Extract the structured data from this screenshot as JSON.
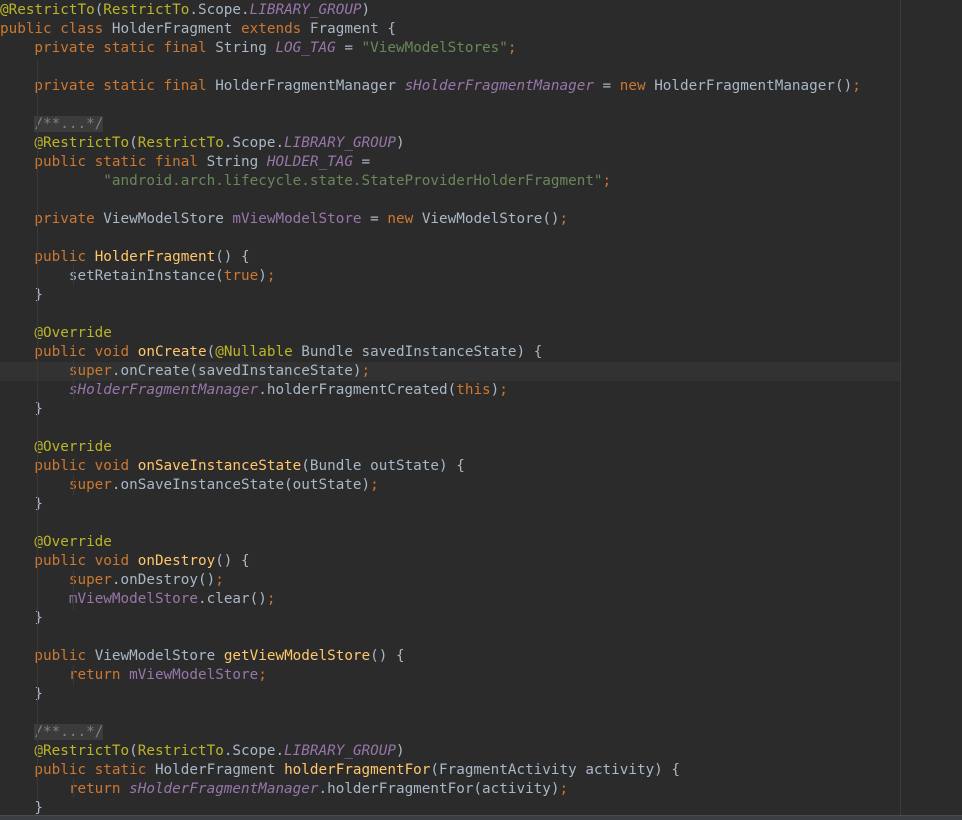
{
  "lines": [
    [
      {
        "t": "@RestrictTo",
        "c": "an"
      },
      {
        "t": "(",
        "c": "tx"
      },
      {
        "t": "RestrictTo",
        "c": "an"
      },
      {
        "t": ".Scope.",
        "c": "tx"
      },
      {
        "t": "LIBRARY_GROUP",
        "c": "fi it"
      },
      {
        "t": ")",
        "c": "tx"
      }
    ],
    [
      {
        "t": "public class ",
        "c": "kw"
      },
      {
        "t": "HolderFragment ",
        "c": "tx"
      },
      {
        "t": "extends ",
        "c": "kw"
      },
      {
        "t": "Fragment {",
        "c": "tx"
      }
    ],
    [
      {
        "t": "    private static final ",
        "c": "kw"
      },
      {
        "t": "String ",
        "c": "tx"
      },
      {
        "t": "LOG_TAG",
        "c": "fi it"
      },
      {
        "t": " = ",
        "c": "tx"
      },
      {
        "t": "\"ViewModelStores\"",
        "c": "st"
      },
      {
        "t": ";",
        "c": "kw"
      }
    ],
    [],
    [
      {
        "t": "    private static final ",
        "c": "kw"
      },
      {
        "t": "HolderFragmentManager ",
        "c": "tx"
      },
      {
        "t": "sHolderFragmentManager",
        "c": "fi it"
      },
      {
        "t": " = ",
        "c": "tx"
      },
      {
        "t": "new ",
        "c": "kw"
      },
      {
        "t": "HolderFragmentManager()",
        "c": "tx"
      },
      {
        "t": ";",
        "c": "kw"
      }
    ],
    [],
    [
      {
        "t": "    ",
        "c": "tx"
      },
      {
        "t": "/**...*/",
        "c": "cm fold"
      }
    ],
    [
      {
        "t": "    @RestrictTo",
        "c": "an"
      },
      {
        "t": "(",
        "c": "tx"
      },
      {
        "t": "RestrictTo",
        "c": "an"
      },
      {
        "t": ".Scope.",
        "c": "tx"
      },
      {
        "t": "LIBRARY_GROUP",
        "c": "fi it"
      },
      {
        "t": ")",
        "c": "tx"
      }
    ],
    [
      {
        "t": "    public static final ",
        "c": "kw"
      },
      {
        "t": "String ",
        "c": "tx"
      },
      {
        "t": "HOLDER_TAG",
        "c": "fi it"
      },
      {
        "t": " =",
        "c": "tx"
      }
    ],
    [
      {
        "t": "            ",
        "c": "tx"
      },
      {
        "t": "\"android.arch.lifecycle.state.StateProviderHolderFragment\"",
        "c": "st"
      },
      {
        "t": ";",
        "c": "kw"
      }
    ],
    [],
    [
      {
        "t": "    private ",
        "c": "kw"
      },
      {
        "t": "ViewModelStore ",
        "c": "tx"
      },
      {
        "t": "mViewModelStore",
        "c": "fi"
      },
      {
        "t": " = ",
        "c": "tx"
      },
      {
        "t": "new ",
        "c": "kw"
      },
      {
        "t": "ViewModelStore()",
        "c": "tx"
      },
      {
        "t": ";",
        "c": "kw"
      }
    ],
    [],
    [
      {
        "t": "    public ",
        "c": "kw"
      },
      {
        "t": "HolderFragment",
        "c": "fn"
      },
      {
        "t": "() {",
        "c": "tx"
      }
    ],
    [
      {
        "t": "        setRetainInstance(",
        "c": "tx"
      },
      {
        "t": "true",
        "c": "kw"
      },
      {
        "t": ")",
        "c": "tx"
      },
      {
        "t": ";",
        "c": "kw"
      }
    ],
    [
      {
        "t": "    }",
        "c": "tx"
      }
    ],
    [],
    [
      {
        "t": "    @Override",
        "c": "an"
      }
    ],
    [
      {
        "t": "    public void ",
        "c": "kw"
      },
      {
        "t": "onCreate",
        "c": "fn"
      },
      {
        "t": "(",
        "c": "tx"
      },
      {
        "t": "@Nullable ",
        "c": "an"
      },
      {
        "t": "Bundle savedInstanceState) {",
        "c": "tx"
      }
    ],
    [
      {
        "t": "        super",
        "c": "kw"
      },
      {
        "t": ".onCreate(savedInstanceState)",
        "c": "tx"
      },
      {
        "t": ";",
        "c": "kw"
      }
    ],
    [
      {
        "t": "        ",
        "c": "tx"
      },
      {
        "t": "sHolderFragmentManager",
        "c": "fi it"
      },
      {
        "t": ".holderFragmentCreated(",
        "c": "tx"
      },
      {
        "t": "this",
        "c": "kw"
      },
      {
        "t": ")",
        "c": "tx"
      },
      {
        "t": ";",
        "c": "kw"
      }
    ],
    [
      {
        "t": "    }",
        "c": "tx"
      }
    ],
    [],
    [
      {
        "t": "    @Override",
        "c": "an"
      }
    ],
    [
      {
        "t": "    public void ",
        "c": "kw"
      },
      {
        "t": "onSaveInstanceState",
        "c": "fn"
      },
      {
        "t": "(Bundle outState) {",
        "c": "tx"
      }
    ],
    [
      {
        "t": "        super",
        "c": "kw"
      },
      {
        "t": ".onSaveInstanceState(outState)",
        "c": "tx"
      },
      {
        "t": ";",
        "c": "kw"
      }
    ],
    [
      {
        "t": "    }",
        "c": "tx"
      }
    ],
    [],
    [
      {
        "t": "    @Override",
        "c": "an"
      }
    ],
    [
      {
        "t": "    public void ",
        "c": "kw"
      },
      {
        "t": "onDestroy",
        "c": "fn"
      },
      {
        "t": "() {",
        "c": "tx"
      }
    ],
    [
      {
        "t": "        super",
        "c": "kw"
      },
      {
        "t": ".onDestroy()",
        "c": "tx"
      },
      {
        "t": ";",
        "c": "kw"
      }
    ],
    [
      {
        "t": "        ",
        "c": "tx"
      },
      {
        "t": "mViewModelStore",
        "c": "fi"
      },
      {
        "t": ".clear()",
        "c": "tx"
      },
      {
        "t": ";",
        "c": "kw"
      }
    ],
    [
      {
        "t": "    }",
        "c": "tx"
      }
    ],
    [],
    [
      {
        "t": "    public ",
        "c": "kw"
      },
      {
        "t": "ViewModelStore ",
        "c": "tx"
      },
      {
        "t": "getViewModelStore",
        "c": "fn"
      },
      {
        "t": "() {",
        "c": "tx"
      }
    ],
    [
      {
        "t": "        return ",
        "c": "kw"
      },
      {
        "t": "mViewModelStore",
        "c": "fi"
      },
      {
        "t": ";",
        "c": "kw"
      }
    ],
    [
      {
        "t": "    }",
        "c": "tx"
      }
    ],
    [],
    [
      {
        "t": "    ",
        "c": "tx"
      },
      {
        "t": "/**...*/",
        "c": "cm fold"
      }
    ],
    [
      {
        "t": "    @RestrictTo",
        "c": "an"
      },
      {
        "t": "(",
        "c": "tx"
      },
      {
        "t": "RestrictTo",
        "c": "an"
      },
      {
        "t": ".Scope.",
        "c": "tx"
      },
      {
        "t": "LIBRARY_GROUP",
        "c": "fi it"
      },
      {
        "t": ")",
        "c": "tx"
      }
    ],
    [
      {
        "t": "    public static ",
        "c": "kw"
      },
      {
        "t": "HolderFragment ",
        "c": "tx"
      },
      {
        "t": "holderFragmentFor",
        "c": "fn"
      },
      {
        "t": "(FragmentActivity activity) {",
        "c": "tx"
      }
    ],
    [
      {
        "t": "        return ",
        "c": "kw"
      },
      {
        "t": "sHolderFragmentManager",
        "c": "fi it"
      },
      {
        "t": ".holderFragmentFor(activity)",
        "c": "tx"
      },
      {
        "t": ";",
        "c": "kw"
      }
    ],
    [
      {
        "t": "    }",
        "c": "tx"
      }
    ]
  ]
}
